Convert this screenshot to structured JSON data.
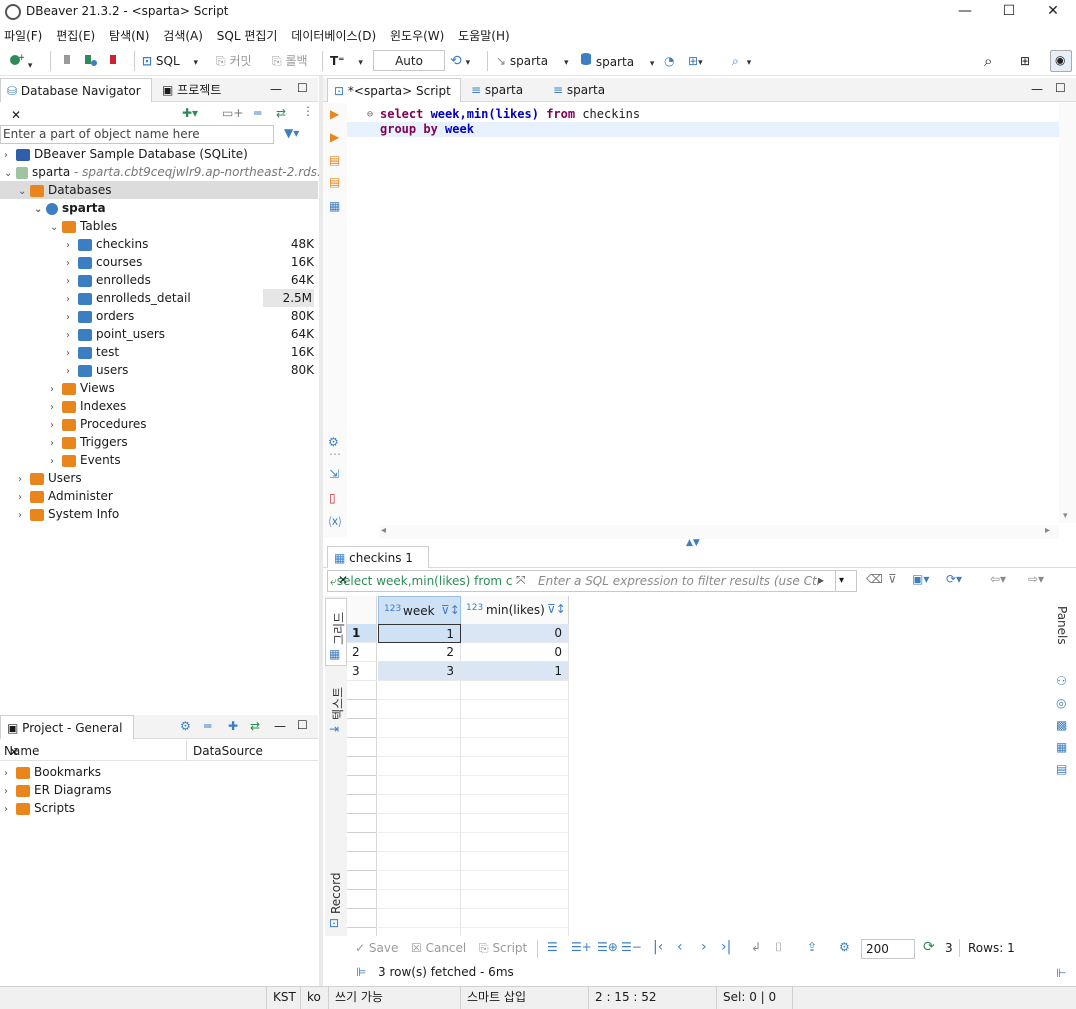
{
  "window": {
    "title": "DBeaver 21.3.2 - <sparta> Script"
  },
  "menu": [
    "파일(F)",
    "편집(E)",
    "탐색(N)",
    "검색(A)",
    "SQL 편집기",
    "데이터베이스(D)",
    "윈도우(W)",
    "도움말(H)"
  ],
  "toolbar": {
    "sql_label": "SQL",
    "commit_label": "커밋",
    "rollback_label": "롤백",
    "tx_mode": "Auto",
    "datasource_1": "sparta",
    "datasource_2": "sparta"
  },
  "navigator": {
    "tab_label": "Database Navigator",
    "tab2_label": "프로젝트",
    "filter_placeholder": "Enter a part of object name here",
    "sample_db": "DBeaver Sample Database (SQLite)",
    "connection_name": "sparta",
    "connection_host": " - sparta.cbt9ceqjwlr9.ap-northeast-2.rds.ama",
    "databases_label": "Databases",
    "schema_label": "sparta",
    "tables_label": "Tables",
    "tables": [
      {
        "name": "checkins",
        "size": "48K"
      },
      {
        "name": "courses",
        "size": "16K"
      },
      {
        "name": "enrolleds",
        "size": "64K"
      },
      {
        "name": "enrolleds_detail",
        "size": "2.5M"
      },
      {
        "name": "orders",
        "size": "80K"
      },
      {
        "name": "point_users",
        "size": "64K"
      },
      {
        "name": "test",
        "size": "16K"
      },
      {
        "name": "users",
        "size": "80K"
      }
    ],
    "folders": [
      "Views",
      "Indexes",
      "Procedures",
      "Triggers",
      "Events"
    ],
    "top_items": [
      "Users",
      "Administer",
      "System Info"
    ]
  },
  "project": {
    "tab_label": "Project - General",
    "col_name": "Name",
    "col_datasource": "DataSource",
    "items": [
      "Bookmarks",
      "ER Diagrams",
      "Scripts"
    ]
  },
  "editor": {
    "tabs": [
      "*<sparta> Script",
      "sparta",
      "sparta"
    ],
    "line1": {
      "kw1": "select",
      "rest1": " week,min(likes) ",
      "kw2": "from",
      "rest2": " checkins"
    },
    "line2": {
      "kw1": "group by",
      "rest1": " week"
    }
  },
  "results": {
    "tab_label": "checkins 1",
    "query_preview": "select week,min(likes) from ch",
    "filter_placeholder": "Enter a SQL expression to filter results (use Ctrl+Sp",
    "columns": [
      "week",
      "min(likes)"
    ],
    "col_type_badge": "123",
    "rows": [
      {
        "num": "1",
        "week": "1",
        "min": "0"
      },
      {
        "num": "2",
        "week": "2",
        "min": "0"
      },
      {
        "num": "3",
        "week": "3",
        "min": "1"
      }
    ],
    "side_grid_label": "그리드",
    "side_text_label": "텍스트",
    "side_record_label": "Record",
    "panels_label": "Panels",
    "save_label": "Save",
    "cancel_label": "Cancel",
    "script_label": "Script",
    "fetch_size": "200",
    "row_count": "3",
    "rows_label": "Rows: 1",
    "fetched_msg": "3 row(s) fetched - 6ms"
  },
  "statusbar": {
    "timezone": "KST",
    "locale": "ko",
    "write_mode": "쓰기 가능",
    "insert_mode": "스마트 삽입",
    "cursor_pos": "2 : 15 : 52",
    "selection": "Sel: 0 | 0"
  },
  "colors": {
    "accent": "#3c7ec2",
    "selection_row": "#dbe6f4",
    "keyword": "#7f0055",
    "toolbar_icon_green": "#2e8b57",
    "folder_orange": "#e8851c"
  }
}
